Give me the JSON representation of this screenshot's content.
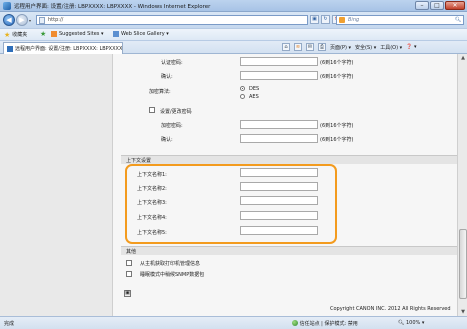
{
  "window": {
    "title": "远程用户界面: 设置/注册: LBPXXXX: LBPXXXX - Windows Internet Explorer",
    "minimize": "–",
    "maximize": "□",
    "close": "✕"
  },
  "address": {
    "url": "http://",
    "search_placeholder": "Bing",
    "back_icon": "back-arrow-icon",
    "forward_icon": "forward-arrow-icon"
  },
  "favorites": {
    "favorites_label": "收藏夹",
    "suggested_sites": "Suggested Sites ▾",
    "web_slice_gallery": "Web Slice Gallery ▾"
  },
  "tab": {
    "label": "远程用户界面: 设置/注册: LBPXXXX: LBPXXXX"
  },
  "command_bar": {
    "page": "页面(P) ▾",
    "safety": "安全(S) ▾",
    "tools": "工具(O) ▾",
    "help": "❓ ▾"
  },
  "form": {
    "auth_password_label": "认证密码:",
    "auth_password_note": "(6到16个字符)",
    "auth_confirm_label": "确认:",
    "auth_confirm_note": "(6到16个字符)",
    "encryption_algorithm_label": "加密算法:",
    "des_label": "DES",
    "aes_label": "AES",
    "set_change_password_label": "设置/更改密码",
    "encryption_password_label": "加密密码:",
    "encryption_password_note": "(6到16个字符)",
    "enc_confirm_label": "确认:",
    "enc_confirm_note": "(6到16个字符)"
  },
  "context_settings": {
    "title": "上下文设置",
    "items": [
      {
        "label": "上下文名称1:",
        "value": ""
      },
      {
        "label": "上下文名称2:",
        "value": ""
      },
      {
        "label": "上下文名称3:",
        "value": ""
      },
      {
        "label": "上下文名称4:",
        "value": ""
      },
      {
        "label": "上下文名称5:",
        "value": ""
      }
    ]
  },
  "other": {
    "title": "其他",
    "opt1": "从主机获取打印机管理信息",
    "opt2": "睡眠模式中稍候SNMP数据包"
  },
  "footer": {
    "copyright": "Copyright CANON INC. 2012 All Rights Reserved"
  },
  "status": {
    "left": "完成",
    "zone": "信任站点 | 保护模式: 禁用",
    "zoom": "100%"
  }
}
